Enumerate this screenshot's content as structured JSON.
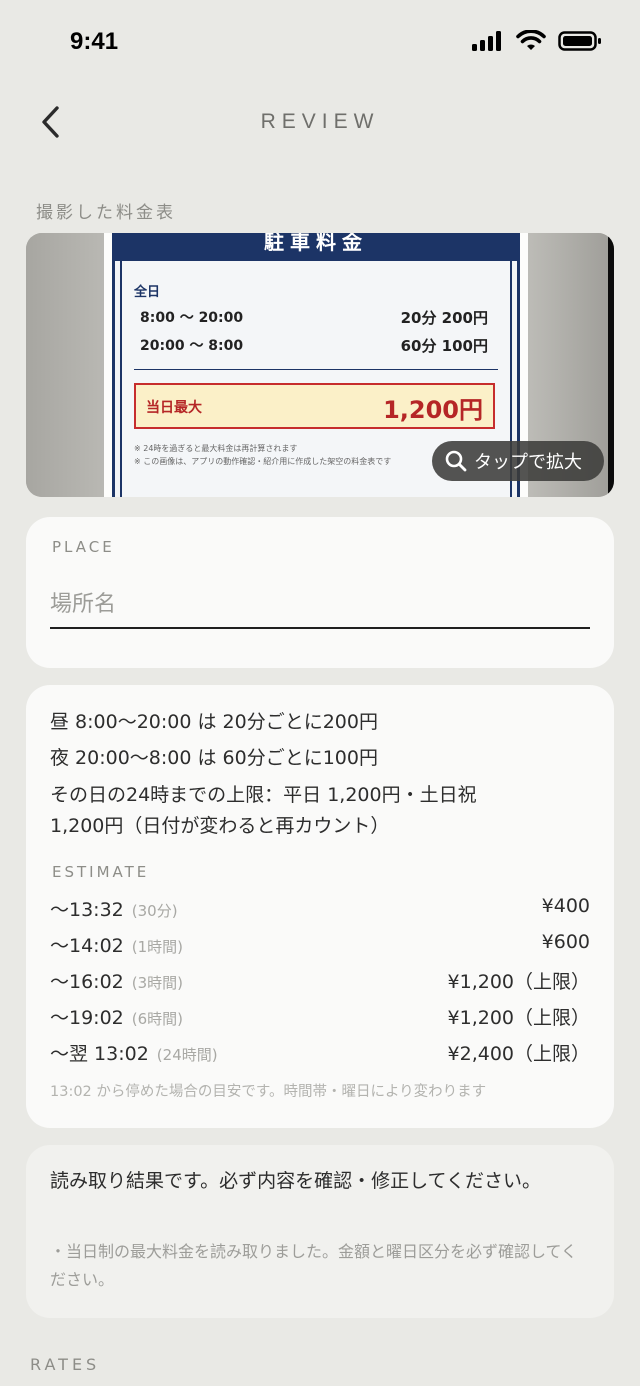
{
  "status_bar": {
    "time": "9:41"
  },
  "nav": {
    "title": "REVIEW"
  },
  "photo_section": {
    "label": "撮影した料金表",
    "zoom_label": "タップで拡大"
  },
  "sign": {
    "header": "駐車料金",
    "allday": "全日",
    "rows": [
      {
        "time": "8:00 〜 20:00",
        "price": "20分  200円"
      },
      {
        "time": "20:00 〜 8:00",
        "price": "60分  100円"
      }
    ],
    "max_label": "当日最大",
    "max_value": "1,200円",
    "note1": "※ 24時を過ぎると最大料金は再計算されます",
    "note2": "※ この画像は、アプリの動作確認・紹介用に作成した架空の料金表です"
  },
  "place": {
    "label": "PLACE",
    "placeholder": "場所名",
    "value": ""
  },
  "rules": {
    "lines": [
      "昼 8:00〜20:00 は 20分ごとに200円",
      "夜 20:00〜8:00 は 60分ごとに100円",
      "その日の24時までの上限：平日 1,200円・土日祝",
      "1,200円（日付が変わると再カウント）"
    ],
    "estimate_label": "ESTIMATE",
    "estimates": [
      {
        "time": "〜13:32",
        "duration": "(30分)",
        "price": "¥400"
      },
      {
        "time": "〜14:02",
        "duration": "(1時間)",
        "price": "¥600"
      },
      {
        "time": "〜16:02",
        "duration": "(3時間)",
        "price": "¥1,200（上限）"
      },
      {
        "time": "〜19:02",
        "duration": "(6時間)",
        "price": "¥1,200（上限）"
      },
      {
        "time": "〜翌 13:02",
        "duration": "(24時間)",
        "price": "¥2,400（上限）"
      }
    ],
    "note": "13:02 から停めた場合の目安です。時間帯・曜日により変わります"
  },
  "notice": {
    "main": "読み取り結果です。必ず内容を確認・修正してください。",
    "sub": "・当日制の最大料金を読み取りました。金額と曜日区分を必ず確認してください。"
  },
  "rates": {
    "label": "RATES"
  },
  "colors": {
    "background": "#e9e9e5",
    "card": "#fafaf9",
    "sign_navy": "#1c3466",
    "sign_red": "#c62d2d"
  }
}
